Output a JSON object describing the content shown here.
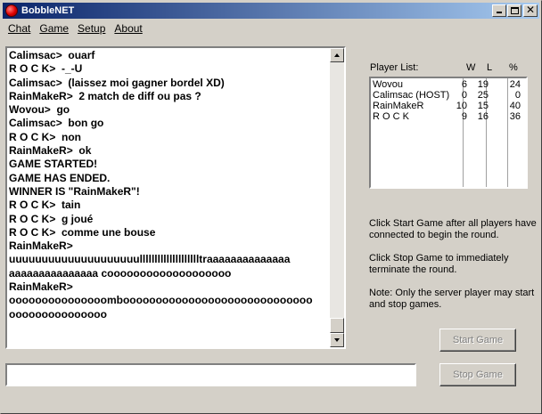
{
  "window": {
    "title": "BobbleNET",
    "colors": {
      "title_start": "#0a246a",
      "title_end": "#a6caf0",
      "face": "#d4d0c8"
    },
    "icon": "red-ball-icon"
  },
  "menu": [
    {
      "label": "Chat"
    },
    {
      "label": "Game"
    },
    {
      "label": "Setup"
    },
    {
      "label": "About"
    }
  ],
  "chat": {
    "lines": [
      "Calimsac>  ouarf",
      "R O C K>  -_-U",
      "Calimsac>  (laissez moi gagner bordel XD)",
      "RainMakeR>  2 match de diff ou pas ?",
      "Wovou>  go",
      "Calimsac>  bon go",
      "R O C K>  non",
      "RainMakeR>  ok",
      "GAME STARTED!",
      "GAME HAS ENDED.",
      "WINNER IS \"RainMakeR\"!",
      "R O C K>  tain",
      "R O C K>  g joué",
      "R O C K>  comme une bouse",
      "RainMakeR>",
      "uuuuuuuuuuuuuuuuuuuulllllllllllllllllllltraaaaaaaaaaaaaa",
      "aaaaaaaaaaaaaaa cooooooooooooooooooo",
      "RainMakeR>",
      "ooooooooooooooombooooooooooooooooooooooooooooo",
      "ooooooooooooooo"
    ]
  },
  "input": {
    "value": "",
    "placeholder": ""
  },
  "players": {
    "header": {
      "label": "Player List:",
      "w": "W",
      "l": "L",
      "pct": "%"
    },
    "rows": [
      {
        "name": "Wovou",
        "w": "6",
        "l": "19",
        "pct": "24"
      },
      {
        "name": "Calimsac (HOST)",
        "w": "0",
        "l": "25",
        "pct": "0"
      },
      {
        "name": "RainMakeR",
        "w": "10",
        "l": "15",
        "pct": "40"
      },
      {
        "name": "R O C K",
        "w": "9",
        "l": "16",
        "pct": "36"
      }
    ]
  },
  "help": {
    "start": "Click Start Game after all players have connected to begin the round.",
    "stop": "Click Stop Game to immediately terminate the round.",
    "note": "Note: Only the server player may start and stop games."
  },
  "buttons": {
    "start": "Start Game",
    "stop": "Stop Game"
  }
}
